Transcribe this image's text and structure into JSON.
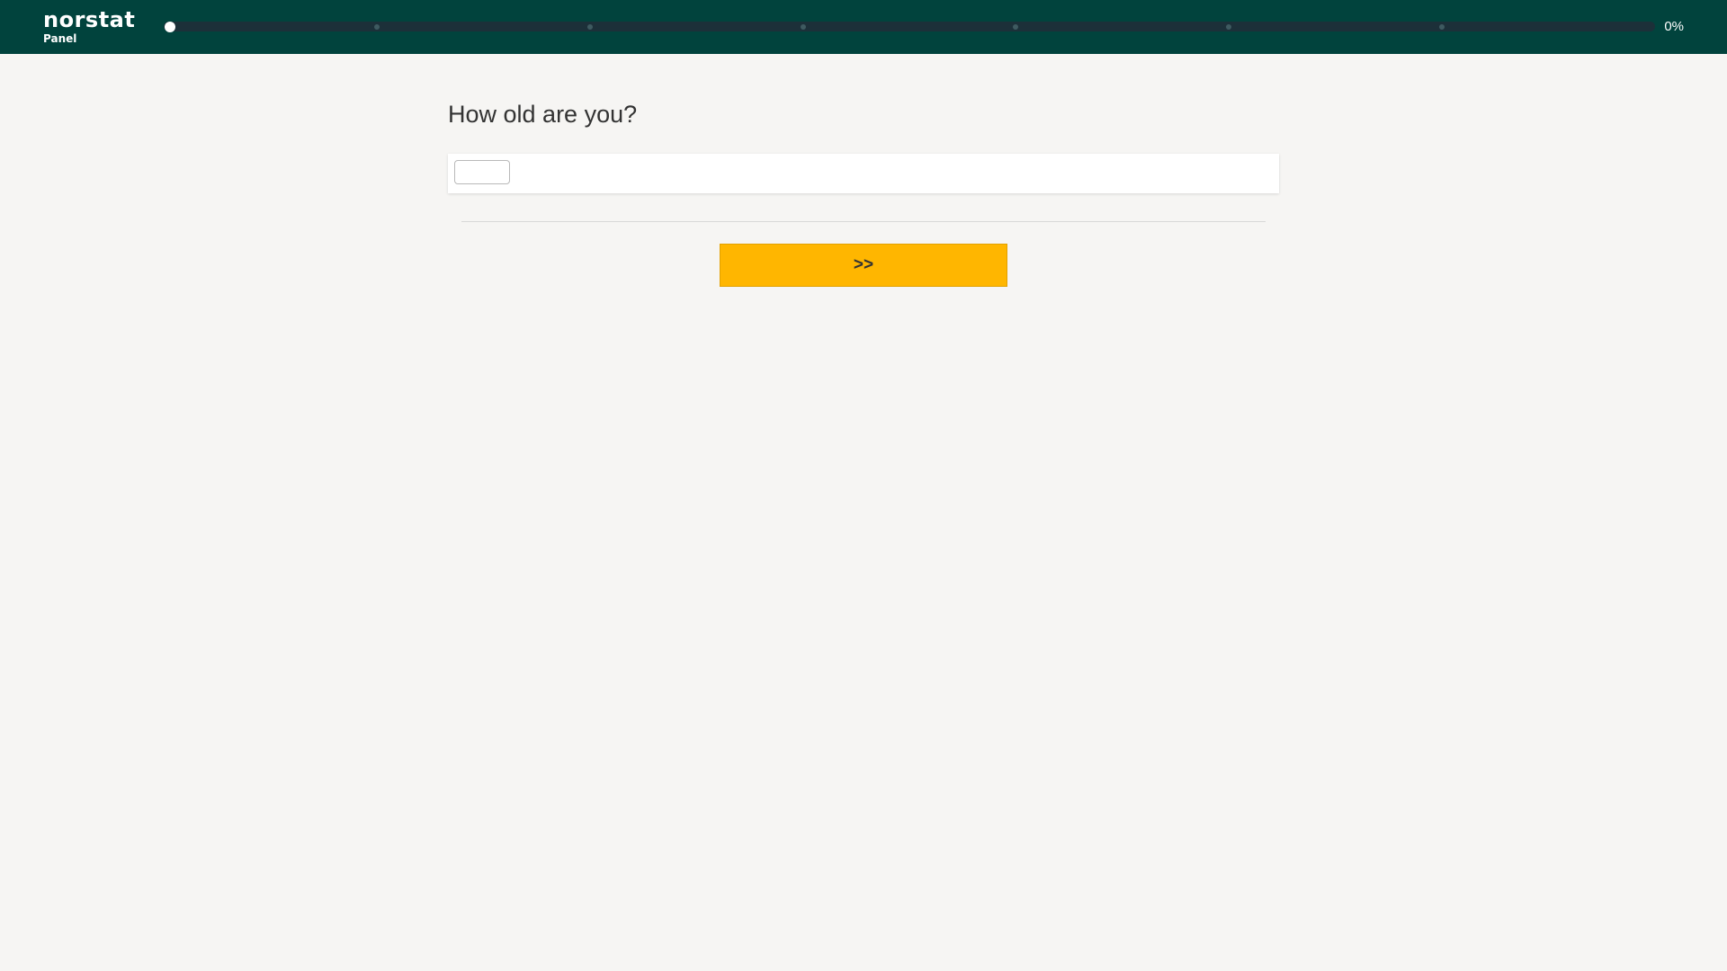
{
  "header": {
    "logo_text": "norstat",
    "logo_subtext": "Panel",
    "progress_label": "0%",
    "progress_value": 0,
    "progress_steps": 7
  },
  "survey": {
    "question": "How old are you?",
    "answer_value": "",
    "next_label": ">>"
  },
  "colors": {
    "header_bg": "#01433d",
    "accent": "#ffb600",
    "page_bg": "#f6f5f3"
  }
}
